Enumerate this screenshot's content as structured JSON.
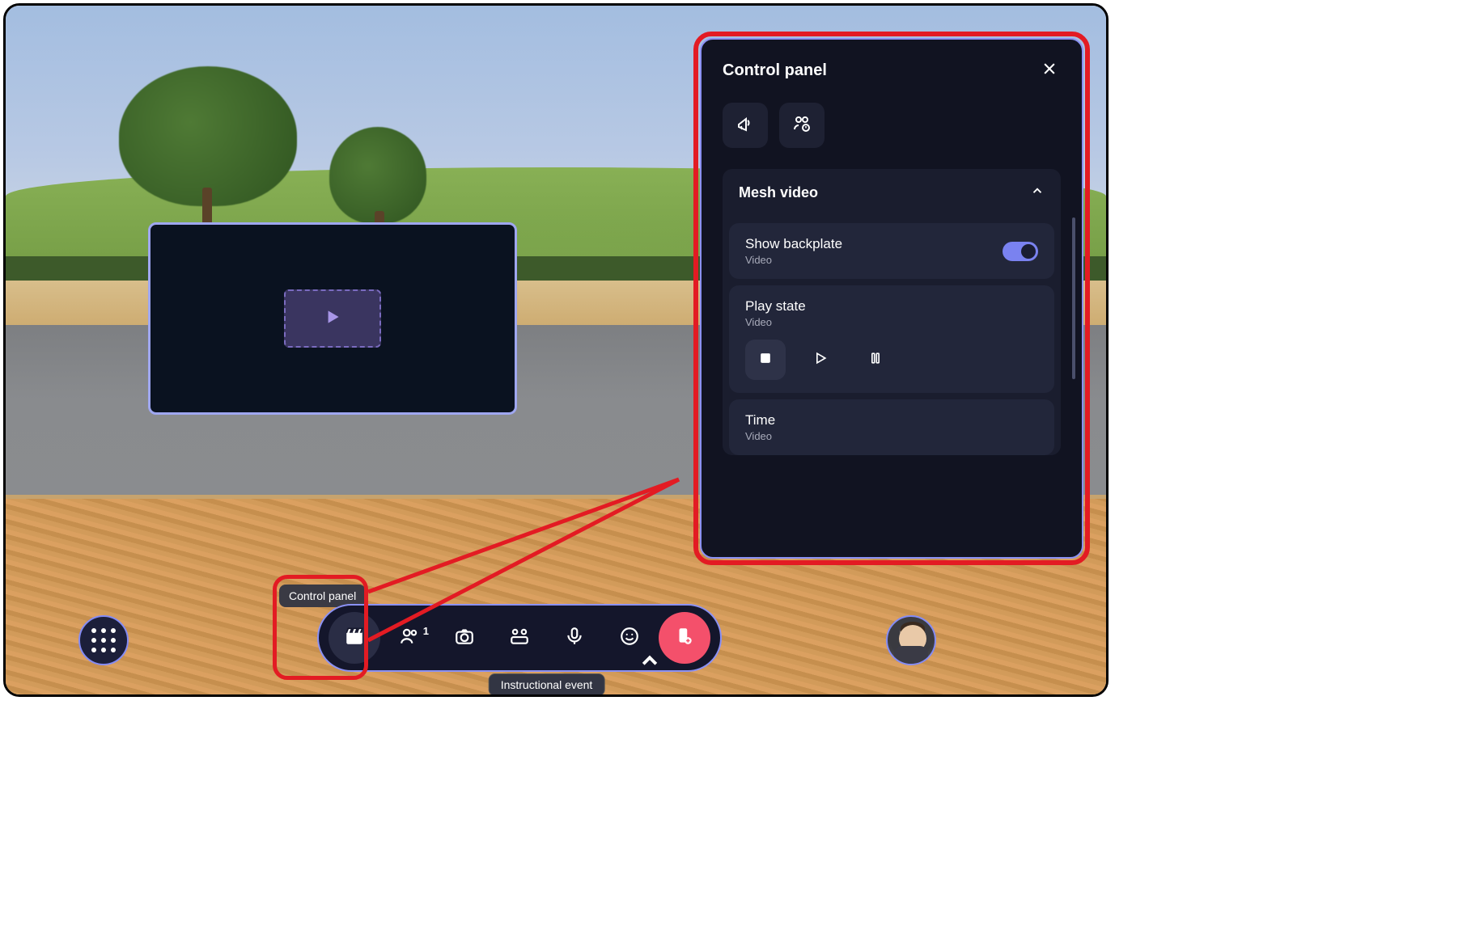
{
  "tooltip": {
    "control_panel": "Control panel"
  },
  "caption": "Instructional event",
  "toolbar": {
    "participants_count": "1"
  },
  "panel": {
    "title": "Control panel",
    "sections": {
      "mesh_video": {
        "title": "Mesh video",
        "backplate": {
          "label": "Show backplate",
          "sub": "Video"
        },
        "playstate": {
          "label": "Play state",
          "sub": "Video"
        },
        "time": {
          "label": "Time",
          "sub": "Video"
        }
      }
    }
  }
}
